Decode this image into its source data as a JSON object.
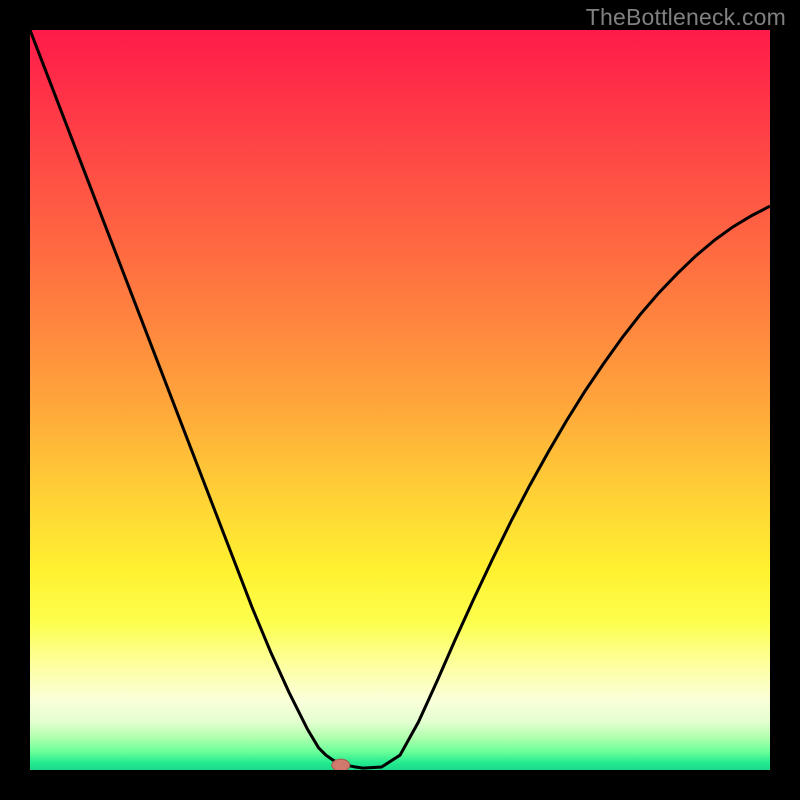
{
  "watermark": "TheBottleneck.com",
  "chart_data": {
    "type": "line",
    "title": "",
    "xlabel": "",
    "ylabel": "",
    "xlim": [
      0,
      100
    ],
    "ylim": [
      0,
      100
    ],
    "x": [
      0,
      2.5,
      5,
      7.5,
      10,
      12.5,
      15,
      17.5,
      20,
      22.5,
      25,
      27.5,
      30,
      32.5,
      35,
      37.5,
      39,
      40,
      41,
      42,
      43,
      44,
      45,
      47.5,
      50,
      52.5,
      55,
      57.5,
      60,
      62.5,
      65,
      67.5,
      70,
      72.5,
      75,
      77.5,
      80,
      82.5,
      85,
      87.5,
      90,
      92.5,
      95,
      97.5,
      100
    ],
    "values": [
      100,
      93.5,
      87,
      80.5,
      74,
      67.5,
      61,
      54.5,
      48,
      41.5,
      35,
      28.5,
      22,
      16,
      10.5,
      5.5,
      3,
      2,
      1.3,
      0.9,
      0.6,
      0.4,
      0.25,
      0.4,
      2,
      6.5,
      12,
      17.7,
      23.2,
      28.5,
      33.6,
      38.4,
      42.9,
      47.2,
      51.2,
      54.9,
      58.4,
      61.6,
      64.5,
      67.1,
      69.5,
      71.6,
      73.4,
      74.9,
      76.2
    ],
    "marker": {
      "x": 42,
      "y": 0.25,
      "color": "#cf7a6c"
    },
    "gradient_stops": [
      {
        "offset": 0.0,
        "color": "#ff1a4a"
      },
      {
        "offset": 0.12,
        "color": "#ff3b47"
      },
      {
        "offset": 0.25,
        "color": "#ff5d43"
      },
      {
        "offset": 0.37,
        "color": "#ff7e3f"
      },
      {
        "offset": 0.5,
        "color": "#ffa43b"
      },
      {
        "offset": 0.62,
        "color": "#ffce36"
      },
      {
        "offset": 0.73,
        "color": "#fff130"
      },
      {
        "offset": 0.8,
        "color": "#fdff4d"
      },
      {
        "offset": 0.86,
        "color": "#fdffa2"
      },
      {
        "offset": 0.905,
        "color": "#fbffda"
      },
      {
        "offset": 0.935,
        "color": "#e3ffd0"
      },
      {
        "offset": 0.955,
        "color": "#b4ffb0"
      },
      {
        "offset": 0.975,
        "color": "#6cff9a"
      },
      {
        "offset": 0.99,
        "color": "#24eb90"
      },
      {
        "offset": 1.0,
        "color": "#1bd989"
      }
    ]
  }
}
